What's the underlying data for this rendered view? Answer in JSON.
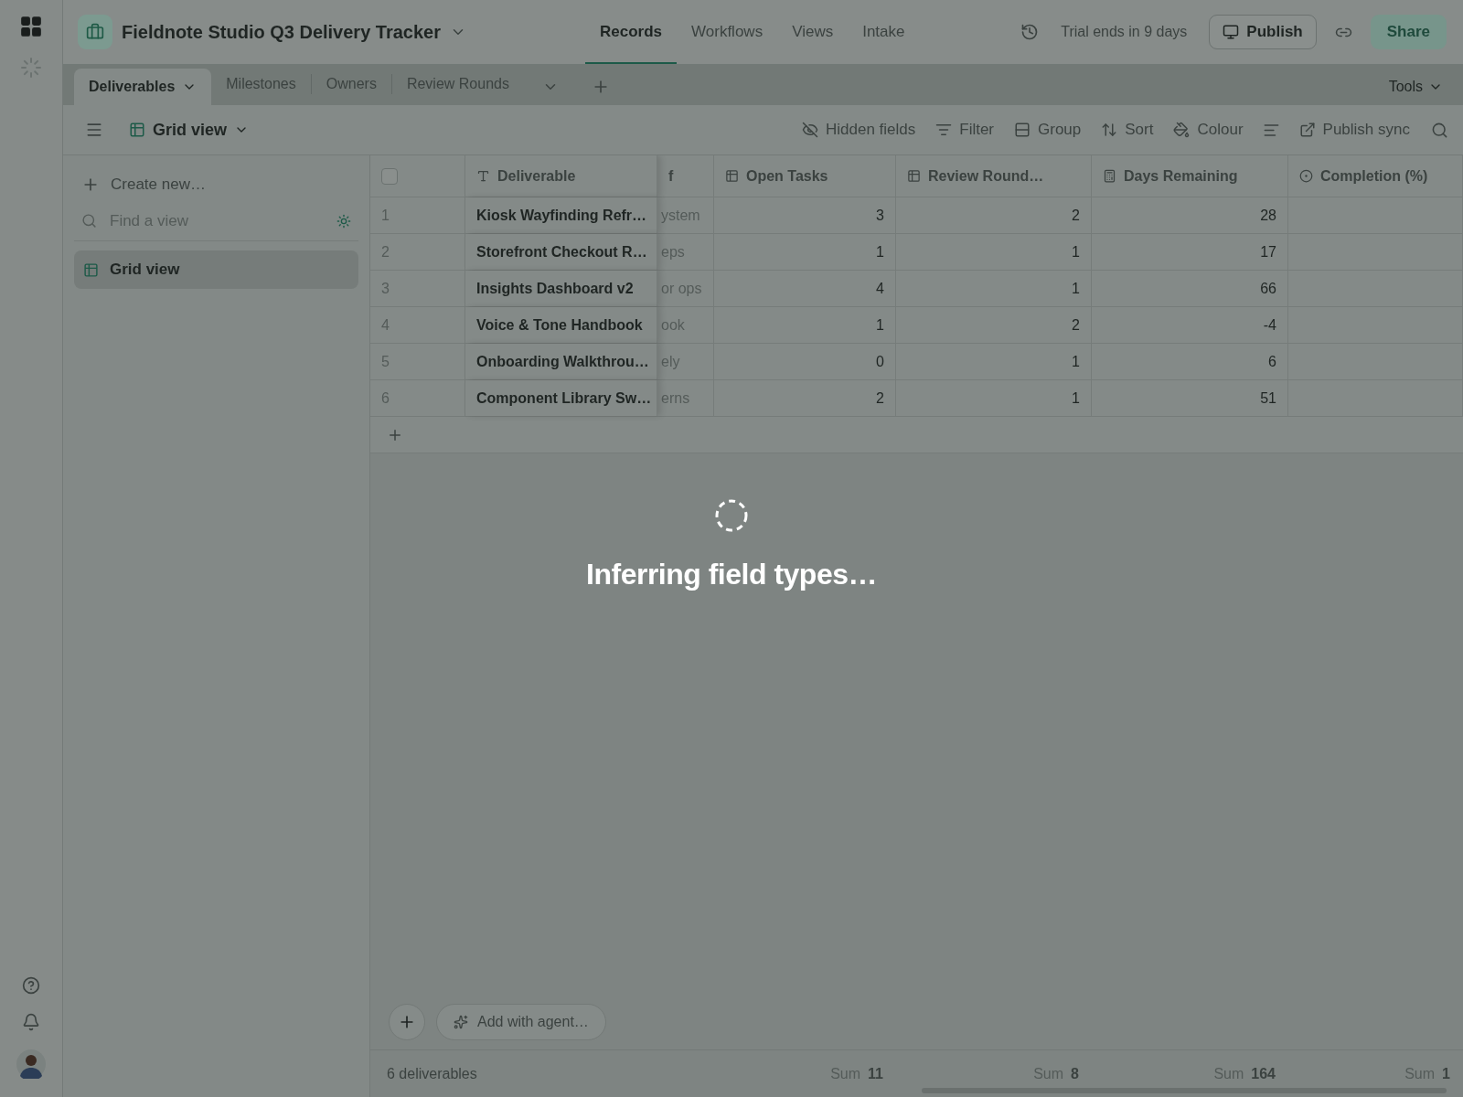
{
  "header": {
    "title": "Fieldnote Studio Q3 Delivery Tracker",
    "nav": [
      {
        "label": "Records",
        "selected": true
      },
      {
        "label": "Workflows",
        "selected": false
      },
      {
        "label": "Views",
        "selected": false
      },
      {
        "label": "Intake",
        "selected": false
      }
    ],
    "trial_notice": "Trial ends in 9 days",
    "publish_button": "Publish",
    "share_button": "Share"
  },
  "table_tabs": [
    {
      "label": "Deliverables",
      "selected": true
    },
    {
      "label": "Milestones",
      "selected": false
    },
    {
      "label": "Owners",
      "selected": false
    },
    {
      "label": "Review Rounds",
      "selected": false
    }
  ],
  "tools_menu": "Tools",
  "toolbar": {
    "view_name": "Grid view",
    "actions": [
      "Hidden fields",
      "Filter",
      "Group",
      "Sort",
      "Colour",
      "Publish sync"
    ]
  },
  "sidebar": {
    "create_label": "Create new…",
    "search": {
      "placeholder": "Find a view"
    },
    "views": [
      {
        "label": "Grid view",
        "selected": true
      }
    ]
  },
  "table": {
    "select_all": {
      "checked": false
    },
    "columns": [
      {
        "label": "Deliverable"
      },
      {
        "label": "f"
      },
      {
        "label": "Open Tasks"
      },
      {
        "label": "Review Round…"
      },
      {
        "label": "Days Remaining"
      },
      {
        "label": "Completion (%)"
      }
    ],
    "rows": [
      {
        "number": "1",
        "cells": [
          "Kiosk Wayfinding Refr…",
          "ystem",
          "3",
          "2",
          "28"
        ]
      },
      {
        "number": "2",
        "cells": [
          "Storefront Checkout R…",
          "eps",
          "1",
          "1",
          "17"
        ]
      },
      {
        "number": "3",
        "cells": [
          "Insights Dashboard v2",
          "or ops",
          "4",
          "1",
          "66"
        ]
      },
      {
        "number": "4",
        "cells": [
          "Voice & Tone Handbook",
          "ook",
          "1",
          "2",
          "-4"
        ]
      },
      {
        "number": "5",
        "cells": [
          "Onboarding Walkthrou…",
          "ely",
          "0",
          "1",
          "6"
        ]
      },
      {
        "number": "6",
        "cells": [
          "Component Library Sw…",
          "erns",
          "2",
          "1",
          "51"
        ]
      }
    ]
  },
  "agent_button": "Add with agent…",
  "footer": {
    "count": "6 deliverables",
    "sums": [
      {
        "label": "Sum",
        "value": "11"
      },
      {
        "label": "Sum",
        "value": "8"
      },
      {
        "label": "Sum",
        "value": "164"
      },
      {
        "label": "Sum",
        "value": "1"
      }
    ]
  },
  "loading": {
    "message": "Inferring field types…"
  }
}
